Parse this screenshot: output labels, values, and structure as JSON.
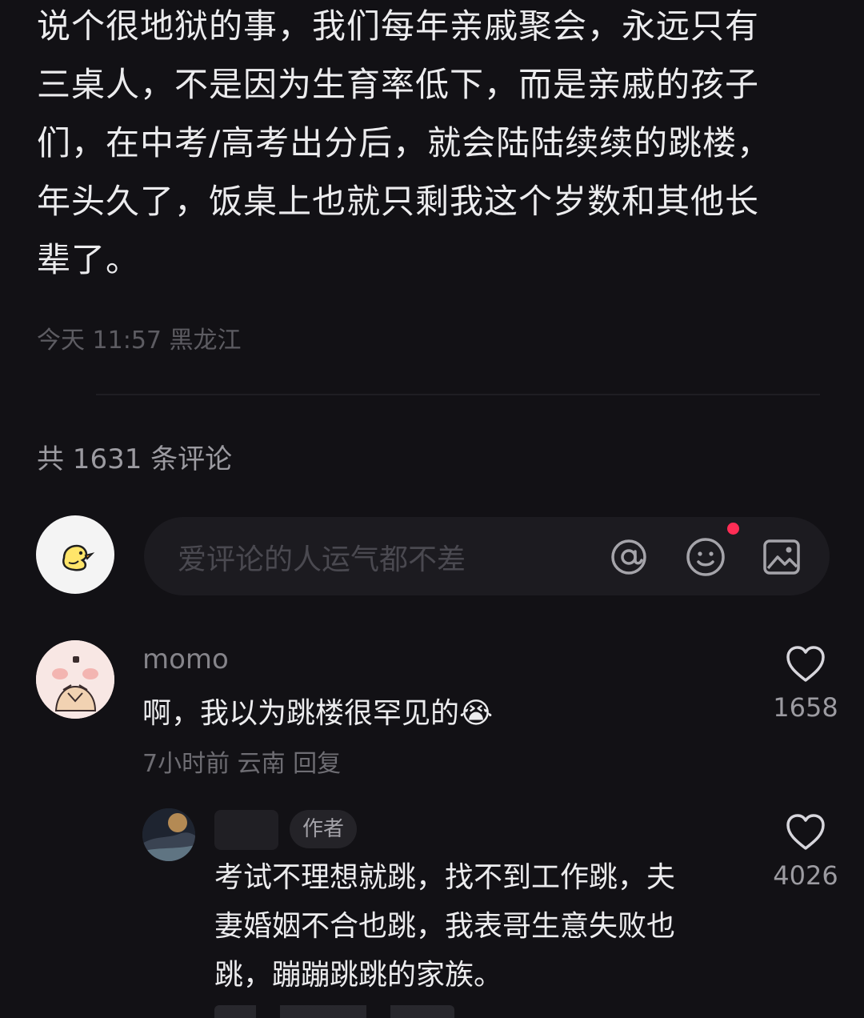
{
  "post": {
    "body": "说个很地狱的事，我们每年亲戚聚会，永远只有\n三桌人，不是因为生育率低下，而是亲戚的孩子\n们，在中考/高考出分后，就会陆陆续续的跳楼，\n年头久了，饭桌上也就只剩我这个岁数和其他长\n辈了。",
    "meta": "今天 11:57 黑龙江"
  },
  "comments_header": {
    "count_label": "共 1631 条评论"
  },
  "comment_input": {
    "placeholder": "爱评论的人运气都不差",
    "has_notification_dot": true
  },
  "comments": [
    {
      "author": "momo",
      "text": "啊，我以为跳楼很罕见的",
      "emoji": "😭",
      "meta": "7小时前 云南 回复",
      "likes": "1658"
    }
  ],
  "replies": [
    {
      "author_badge": "作者",
      "text": "考试不理想就跳，找不到工作跳，夫\n妻婚姻不合也跳，我表哥生意失败也\n跳，蹦蹦跳跳的家族。",
      "likes": "4026"
    }
  ],
  "colors": {
    "background": "#121115",
    "notification_dot": "#ff2d55"
  }
}
